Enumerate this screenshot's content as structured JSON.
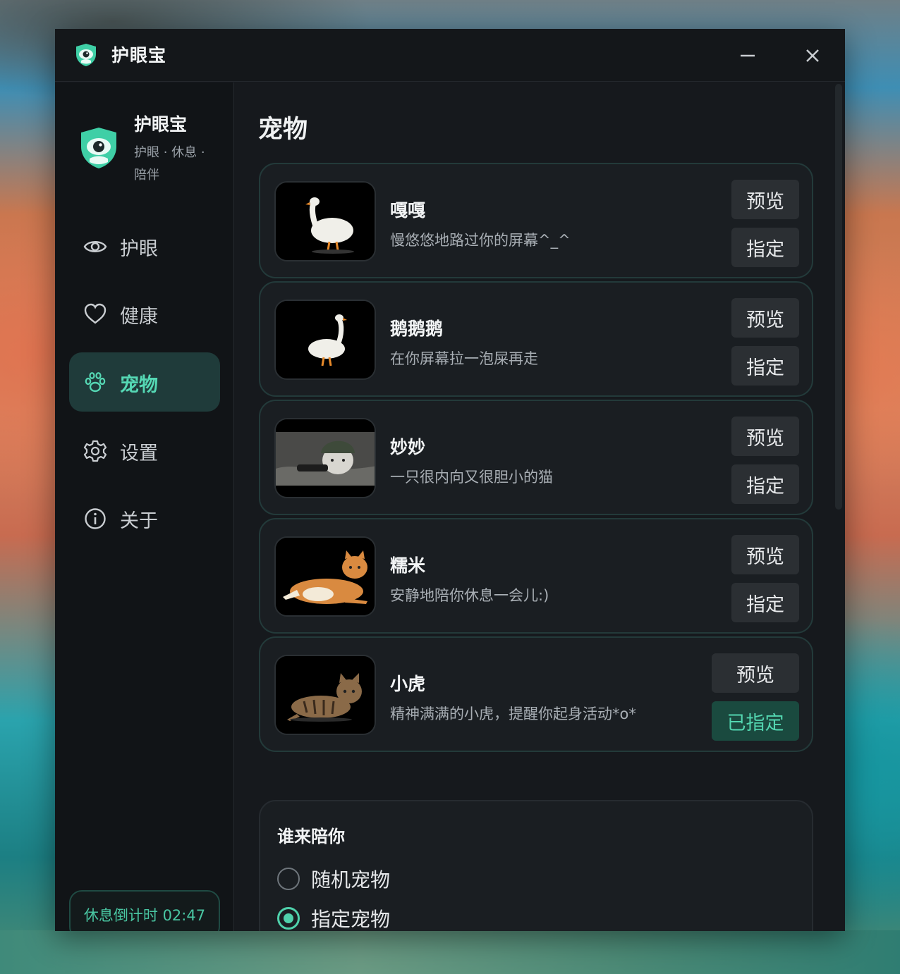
{
  "app": {
    "title": "护眼宝",
    "brand_name": "护眼宝",
    "tagline": "护眼 · 休息 · 陪伴"
  },
  "sidebar": {
    "items": [
      {
        "label": "护眼",
        "icon": "eye-icon",
        "active": false
      },
      {
        "label": "健康",
        "icon": "heart-icon",
        "active": false
      },
      {
        "label": "宠物",
        "icon": "paw-icon",
        "active": true
      },
      {
        "label": "设置",
        "icon": "gear-icon",
        "active": false
      },
      {
        "label": "关于",
        "icon": "info-icon",
        "active": false
      }
    ],
    "countdown": "休息倒计时 02:47"
  },
  "page": {
    "title": "宠物"
  },
  "pets": [
    {
      "name": "嘎嘎",
      "desc": "慢悠悠地路过你的屏幕^_^",
      "thumb": "goose-image",
      "preview_label": "预览",
      "assign_label": "指定",
      "assigned": false
    },
    {
      "name": "鹅鹅鹅",
      "desc": "在你屏幕拉一泡屎再走",
      "thumb": "goose-image",
      "preview_label": "预览",
      "assign_label": "指定",
      "assigned": false
    },
    {
      "name": "妙妙",
      "desc": "一只很内向又很胆小的猫",
      "thumb": "soldier-cat-image",
      "preview_label": "预览",
      "assign_label": "指定",
      "assigned": false
    },
    {
      "name": "糯米",
      "desc": "安静地陪你休息一会儿:)",
      "thumb": "orange-cat-image",
      "preview_label": "预览",
      "assign_label": "指定",
      "assigned": false
    },
    {
      "name": "小虎",
      "desc": "精神满满的小虎，提醒你起身活动*o*",
      "thumb": "tabby-cat-image",
      "preview_label": "预览",
      "assign_label": "已指定",
      "assigned": true
    }
  ],
  "companion": {
    "title": "谁来陪你",
    "options": [
      {
        "label": "随机宠物",
        "checked": false
      },
      {
        "label": "指定宠物",
        "checked": true
      }
    ]
  },
  "colors": {
    "accent": "#4fd1ab",
    "active_nav_bg": "#1f3b3a",
    "assigned_bg": "#1a4a3f"
  }
}
